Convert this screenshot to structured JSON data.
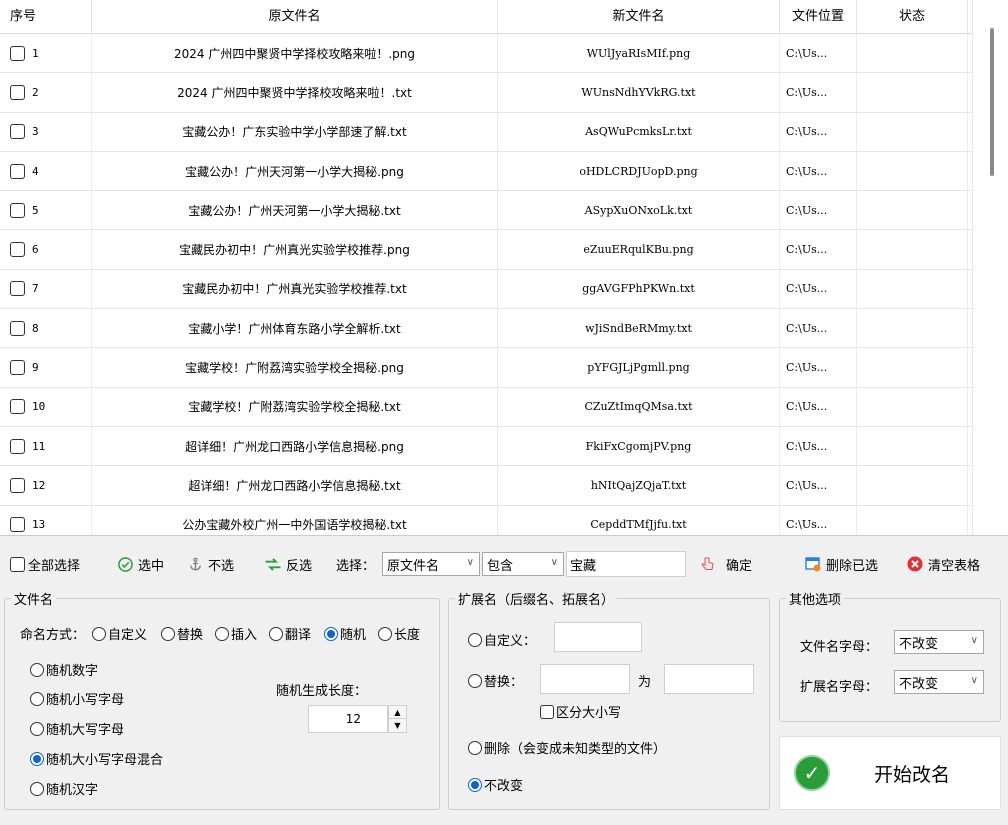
{
  "table": {
    "headers": {
      "no": "序号",
      "old": "原文件名",
      "new": "新文件名",
      "location": "文件位置",
      "status": "状态"
    },
    "rows": [
      {
        "no": "1",
        "old": "2024 广州四中聚贤中学择校攻略来啦！.png",
        "new": "WUlJyaRIsMIf.png",
        "loc": "C:\\Us...",
        "status": ""
      },
      {
        "no": "2",
        "old": "2024 广州四中聚贤中学择校攻略来啦！.txt",
        "new": "WUnsNdhYVkRG.txt",
        "loc": "C:\\Us...",
        "status": ""
      },
      {
        "no": "3",
        "old": "宝藏公办！广东实验中学小学部速了解.txt",
        "new": "AsQWuPcmksLr.txt",
        "loc": "C:\\Us...",
        "status": ""
      },
      {
        "no": "4",
        "old": "宝藏公办！广州天河第一小学大揭秘.png",
        "new": "oHDLCRDJUopD.png",
        "loc": "C:\\Us...",
        "status": ""
      },
      {
        "no": "5",
        "old": "宝藏公办！广州天河第一小学大揭秘.txt",
        "new": "ASypXuONxoLk.txt",
        "loc": "C:\\Us...",
        "status": ""
      },
      {
        "no": "6",
        "old": "宝藏民办初中！广州真光实验学校推荐.png",
        "new": "eZuuERqulKBu.png",
        "loc": "C:\\Us...",
        "status": ""
      },
      {
        "no": "7",
        "old": "宝藏民办初中！广州真光实验学校推荐.txt",
        "new": "ggAVGFPhPKWn.txt",
        "loc": "C:\\Us...",
        "status": ""
      },
      {
        "no": "8",
        "old": "宝藏小学！广州体育东路小学全解析.txt",
        "new": "wJiSndBeRMmy.txt",
        "loc": "C:\\Us...",
        "status": ""
      },
      {
        "no": "9",
        "old": "宝藏学校！广附荔湾实验学校全揭秘.png",
        "new": "pYFGJLjPgmll.png",
        "loc": "C:\\Us...",
        "status": ""
      },
      {
        "no": "10",
        "old": "宝藏学校！广附荔湾实验学校全揭秘.txt",
        "new": "CZuZtImqQMsa.txt",
        "loc": "C:\\Us...",
        "status": ""
      },
      {
        "no": "11",
        "old": "超详细！广州龙口西路小学信息揭秘.png",
        "new": "FkiFxCgomjPV.png",
        "loc": "C:\\Us...",
        "status": ""
      },
      {
        "no": "12",
        "old": "超详细！广州龙口西路小学信息揭秘.txt",
        "new": "hNItQajZQjaT.txt",
        "loc": "C:\\Us...",
        "status": ""
      },
      {
        "no": "13",
        "old": "公办宝藏外校广州一中外国语学校揭秘.txt",
        "new": "CepddTMfJjfu.txt",
        "loc": "C:\\Us...",
        "status": ""
      }
    ]
  },
  "toolbar": {
    "select_all": "全部选择",
    "select": "选中",
    "unselect": "不选",
    "invert": "反选",
    "choose_label": "选择：",
    "field_select": "原文件名",
    "match_select": "包含",
    "keyword": "宝藏",
    "confirm": "确定",
    "delete_selected": "删除已选",
    "clear_table": "清空表格"
  },
  "filename_group": {
    "title": "文件名",
    "mode_label": "命名方式：",
    "modes": [
      "自定义",
      "替换",
      "插入",
      "翻译",
      "随机",
      "长度"
    ],
    "random_options": [
      "随机数字",
      "随机小写字母",
      "随机大写字母",
      "随机大小写字母混合",
      "随机汉字"
    ],
    "length_label": "随机生成长度：",
    "length_value": "12"
  },
  "ext_group": {
    "title": "扩展名（后缀名、拓展名）",
    "custom": "自定义：",
    "replace": "替换：",
    "to": "为",
    "case_sensitive": "区分大小写",
    "delete": "删除（会变成未知类型的文件）",
    "keep": "不改变"
  },
  "other_group": {
    "title": "其他选项",
    "filename_letter_label": "文件名字母：",
    "filename_letter_value": "不改变",
    "ext_letter_label": "扩展名字母：",
    "ext_letter_value": "不改变"
  },
  "start_button": "开始改名",
  "colors": {
    "accent": "#0a64d2",
    "start_green": "#2a9d3a",
    "delete_red": "#e03030"
  }
}
